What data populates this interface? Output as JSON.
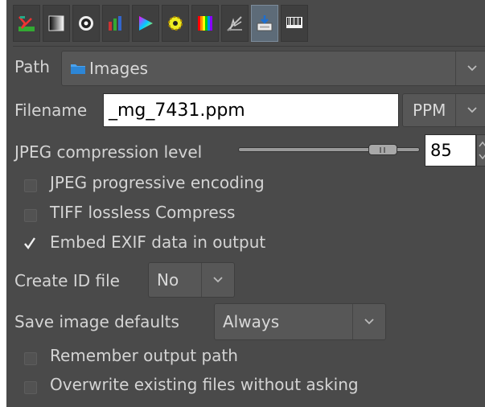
{
  "toolbar": {
    "tools": [
      {
        "name": "histogram-curves-icon"
      },
      {
        "name": "black-white-icon"
      },
      {
        "name": "lens-icon"
      },
      {
        "name": "chart-icon"
      },
      {
        "name": "color-triangle-icon"
      },
      {
        "name": "gear-burst-icon"
      },
      {
        "name": "rainbow-icon"
      },
      {
        "name": "sharpen-icon"
      },
      {
        "name": "save-output-icon",
        "active": true
      },
      {
        "name": "exif-barcode-icon"
      }
    ]
  },
  "path": {
    "label": "Path",
    "value": "Images",
    "icon": "folder-icon"
  },
  "filename": {
    "label": "Filename",
    "value": "_mg_7431.ppm",
    "format": "PPM"
  },
  "jpeg": {
    "label": "JPEG compression level",
    "value": "85",
    "level_fraction": 0.85
  },
  "options": {
    "jpeg_progressive": {
      "label": "JPEG progressive encoding",
      "checked": false
    },
    "tiff_lossless": {
      "label": "TIFF lossless Compress",
      "checked": false
    },
    "embed_exif": {
      "label": "Embed EXIF data in output",
      "checked": true
    }
  },
  "create_id": {
    "label": "Create ID file",
    "value": "No"
  },
  "save_defaults": {
    "label": "Save image defaults",
    "value": "Always"
  },
  "remember_path": {
    "label": "Remember output path",
    "checked": false
  },
  "overwrite": {
    "label": "Overwrite existing files without asking",
    "checked": false
  },
  "colors": {
    "panel": "#4a4a4a",
    "active_tool": "#5d6b78",
    "text": "#d4d4d4"
  }
}
